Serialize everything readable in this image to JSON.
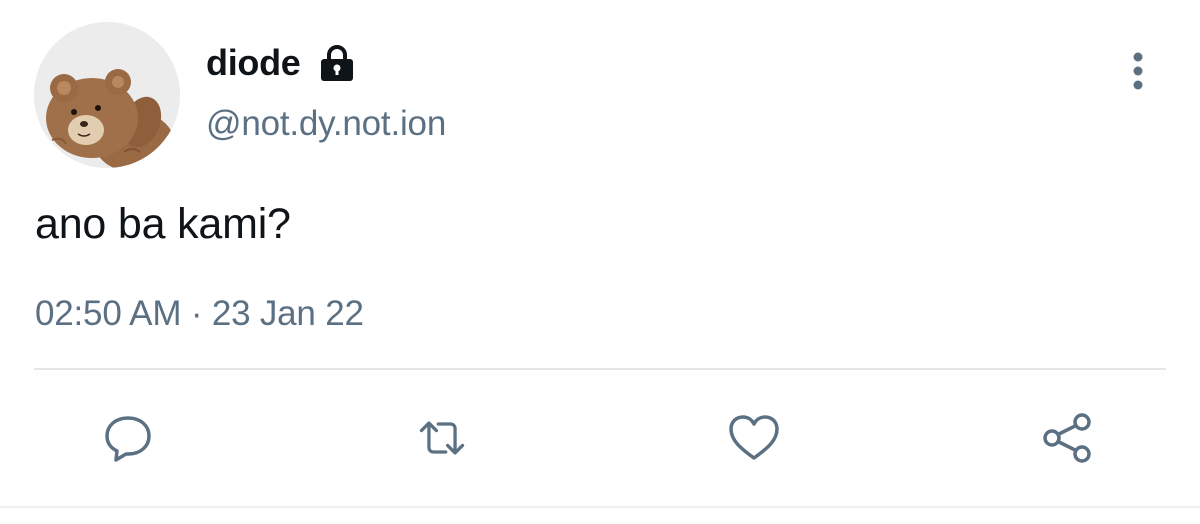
{
  "tweet": {
    "display_name": "diode",
    "handle": "@not.dy.not.ion",
    "text": "ano ba kami?",
    "time": "02:50 AM",
    "separator": "·",
    "date": "23 Jan 22",
    "protected_icon": "lock-icon",
    "more_icon": "vertical-ellipsis-icon"
  },
  "actions": [
    {
      "name": "reply",
      "icon": "comment-bubble-icon"
    },
    {
      "name": "retweet",
      "icon": "retweet-arrows-icon"
    },
    {
      "name": "like",
      "icon": "heart-icon"
    },
    {
      "name": "share",
      "icon": "share-nodes-icon"
    }
  ],
  "colors": {
    "text_primary": "#0f1419",
    "text_secondary": "#5b7083",
    "divider": "#e3e7ea"
  }
}
